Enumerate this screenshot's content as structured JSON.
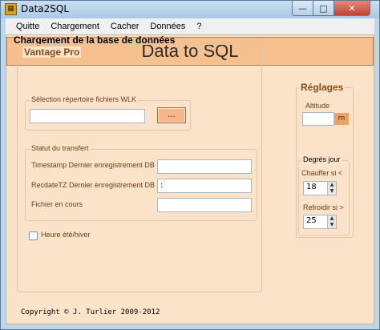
{
  "window": {
    "title": "Data2SQL",
    "icon": "app-icon"
  },
  "titlebar_buttons": {
    "minimize": "—",
    "maximize": "□",
    "close": "✕"
  },
  "menu": {
    "items": [
      "Quitte",
      "Chargement",
      "Cacher",
      "Données",
      "?"
    ]
  },
  "banner": {
    "title": "Data to SQL"
  },
  "section_title": "Chargement de la base de données",
  "vantage": {
    "title": "Vantage Pro",
    "wlk": {
      "title": "Sélection répertoire fichiers WLK",
      "path_value": "",
      "browse_label": "..."
    },
    "transfer": {
      "title": "Statut du transfert",
      "fields": [
        {
          "label": "Timestamp Dernier enregistrement DB",
          "value": ""
        },
        {
          "label": "RecdateTZ Dernier enregistrement DB",
          "value": ":"
        },
        {
          "label": "Fichier en cours",
          "value": ""
        }
      ]
    },
    "dst_checkbox": {
      "label": "Heure été/hiver",
      "checked": false
    }
  },
  "settings": {
    "title": "Réglages",
    "altitude": {
      "label": "Altitude",
      "value": "",
      "unit": "m"
    },
    "degres_jour": {
      "title": "Degrés jour",
      "chauffer": {
        "label": "Chauffer si  <",
        "value": "18"
      },
      "refroidir": {
        "label": "Refroidir si  >",
        "value": "25"
      }
    }
  },
  "footer": {
    "copyright": "Copyright © J. Turlier 2009-2012"
  },
  "colors": {
    "banner": "#f6c08f",
    "panel": "#fbe3c9",
    "frame": "#bdd6ea",
    "group_title": "#8a4b16"
  }
}
